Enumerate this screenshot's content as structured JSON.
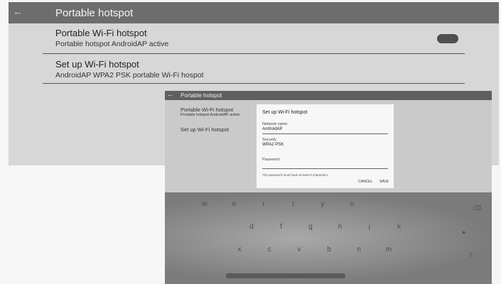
{
  "top": {
    "title": "Portable hotspot",
    "items": [
      {
        "label": "Portable Wi-Fi hotspot",
        "summary": "Portable hotspot AndroidAP active"
      },
      {
        "label": "Set up Wi-Fi hotspot",
        "summary": "AndroidAP WPA2 PSK portable Wi-Fi hospot"
      }
    ]
  },
  "mini": {
    "title": "Portable hotspot",
    "items": [
      {
        "label": "Portable Wi-Fi hotspot",
        "summary": "Portable hotspot AndroidAP active"
      },
      {
        "label": "Set up Wi-Fi hotspot"
      }
    ],
    "dialog": {
      "title": "Set up Wi-Fi hotspot",
      "network_label": "Network name",
      "network_value": "AndroidAP",
      "security_label": "Security",
      "security_value": "WPA2 PSK",
      "password_label": "Password",
      "hint": "The password must have at least 8 characters.",
      "cancel": "CANCEL",
      "save": "SAVE"
    },
    "keyboard": {
      "row1": [
        "w",
        "e",
        "r",
        "t",
        "y",
        "u"
      ],
      "row2": [
        "d",
        "f",
        "g",
        "h",
        "j",
        "k"
      ],
      "row3": [
        "x",
        "c",
        "v",
        "b",
        "n",
        "m"
      ]
    }
  },
  "colors": {
    "title_bar": "#6d6d6d",
    "background": "#d7d7d7",
    "dialog": "#f7f7f7"
  }
}
